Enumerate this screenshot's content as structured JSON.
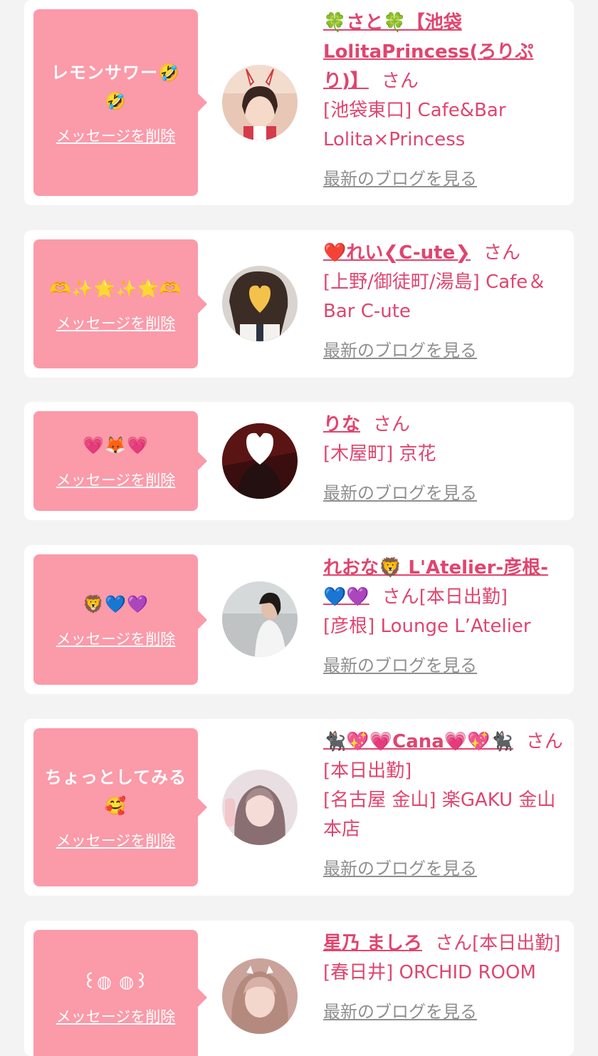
{
  "cards": [
    {
      "message": "レモンサワー🤣🤣",
      "delete_label": "メッセージを削除",
      "name": "🍀さと🍀【池袋LolitaPrincess(ろりぷり)】",
      "suffix": "さん",
      "shop": "[池袋東口] Cafe&Bar Lolita×Princess",
      "blog": "最新のブログを見る"
    },
    {
      "message": "🫶✨🌟✨🌟🫶",
      "delete_label": "メッセージを削除",
      "name": "❤️れい❮C-ute❯",
      "suffix": "さん",
      "shop": "[上野/御徒町/湯島] Cafe＆Bar C-ute",
      "blog": "最新のブログを見る"
    },
    {
      "message": "💗🦊💗",
      "delete_label": "メッセージを削除",
      "name": "りな",
      "suffix": "さん",
      "shop": "[木屋町] 京花",
      "blog": "最新のブログを見る"
    },
    {
      "message": "🦁💙💜",
      "delete_label": "メッセージを削除",
      "name": "れおな🦁 L'Atelier-彦根-💙💜",
      "suffix": "さん[本日出勤]",
      "shop": "[彦根] Lounge L’Atelier",
      "blog": "最新のブログを見る"
    },
    {
      "message": "ちょっとしてみる🥰",
      "delete_label": "メッセージを削除",
      "name": "🐈‍⬛💖💗Cana💗💖🐈‍⬛",
      "suffix": "さん[本日出勤]",
      "shop": "[名古屋 金山] 楽GAKU 金山本店",
      "blog": "最新のブログを見る"
    },
    {
      "message": "꒰◍ ◍꒱",
      "delete_label": "メッセージを削除",
      "name": "星乃 ましろ",
      "suffix": "さん[本日出勤]",
      "shop": "[春日井] ORCHID ROOM",
      "blog": "最新のブログを見る"
    }
  ],
  "colors": {
    "accent": "#e0456f",
    "bubble": "#fb9aa9",
    "muted": "#8f8f8f",
    "background": "#f3f3f3"
  },
  "icons": [
    "avatar-photo"
  ]
}
